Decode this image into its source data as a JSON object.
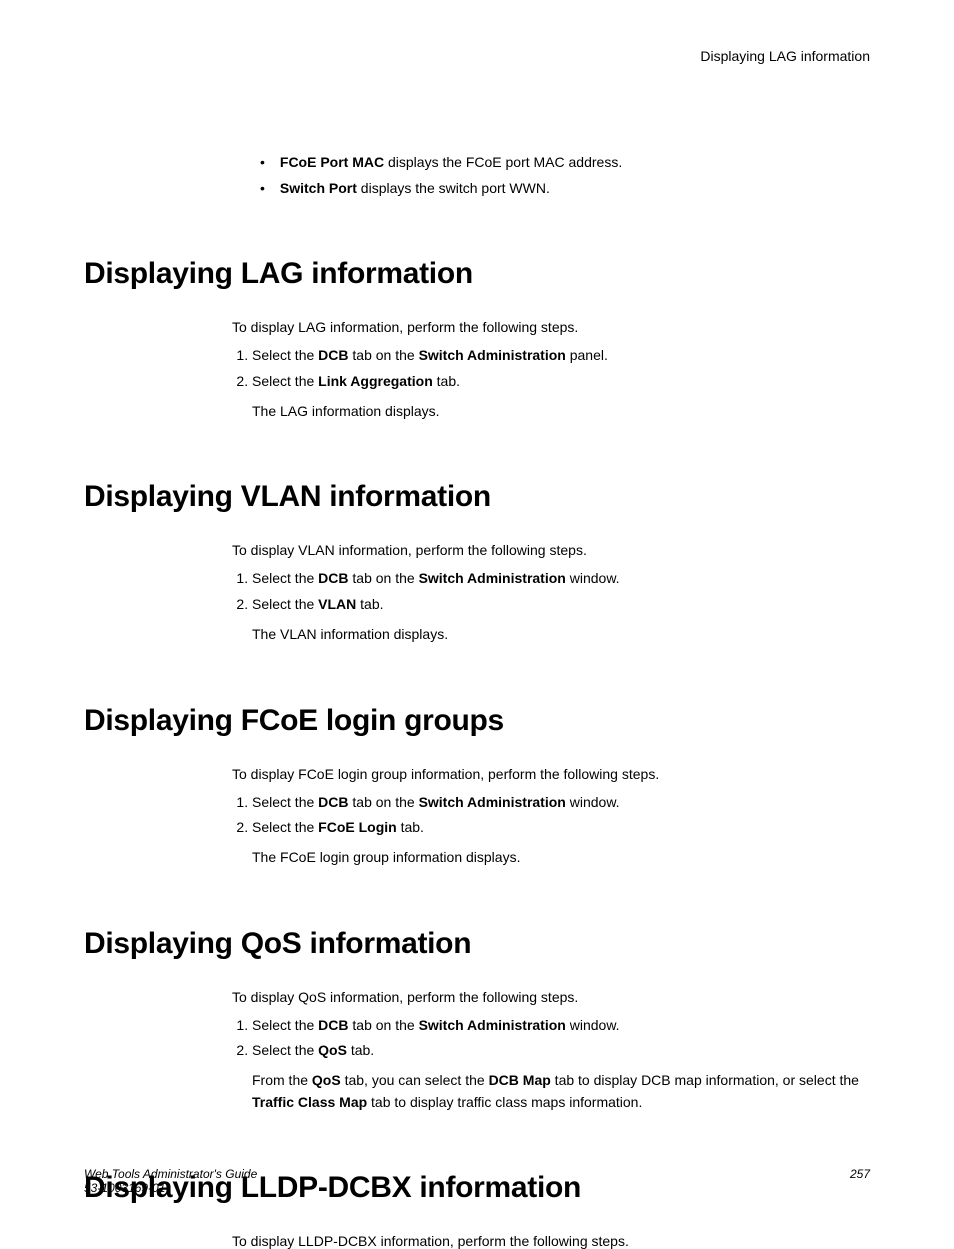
{
  "header": {
    "running": "Displaying LAG information"
  },
  "top_bullets": [
    {
      "bold": "FCoE Port MAC",
      "rest": " displays the FCoE port MAC address."
    },
    {
      "bold": "Switch Port",
      "rest": " displays the switch port WWN."
    }
  ],
  "sections": [
    {
      "heading": "Displaying LAG information",
      "intro": "To display LAG information, perform the following steps.",
      "steps": [
        {
          "pre": "Select the ",
          "b1": "DCB",
          "mid": " tab on the ",
          "b2": "Switch Administration",
          "post": " panel."
        },
        {
          "pre": "Select the ",
          "b1": "Link Aggregation",
          "mid": "",
          "b2": "",
          "post": " tab."
        }
      ],
      "result": "The LAG information displays."
    },
    {
      "heading": "Displaying VLAN information",
      "intro": "To display VLAN information, perform the following steps.",
      "steps": [
        {
          "pre": "Select the ",
          "b1": "DCB",
          "mid": " tab on the ",
          "b2": "Switch Administration",
          "post": " window."
        },
        {
          "pre": "Select the ",
          "b1": "VLAN",
          "mid": "",
          "b2": "",
          "post": " tab."
        }
      ],
      "result": "The VLAN information displays."
    },
    {
      "heading": "Displaying FCoE login groups",
      "intro": "To display FCoE login group information, perform the following steps.",
      "steps": [
        {
          "pre": "Select the ",
          "b1": "DCB",
          "mid": " tab on the ",
          "b2": "Switch Administration",
          "post": " window."
        },
        {
          "pre": "Select the ",
          "b1": "FCoE Login",
          "mid": "",
          "b2": "",
          "post": " tab."
        }
      ],
      "result": "The FCoE login group information displays."
    },
    {
      "heading": "Displaying QoS information",
      "intro": "To display QoS information, perform the following steps.",
      "steps": [
        {
          "pre": "Select the ",
          "b1": "DCB",
          "mid": " tab on the ",
          "b2": "Switch Administration",
          "post": " window."
        },
        {
          "pre": "Select the ",
          "b1": "QoS",
          "mid": "",
          "b2": "",
          "post": " tab."
        }
      ],
      "result_rich": {
        "p1": "From the ",
        "b1": "QoS",
        "p2": " tab, you can select the ",
        "b2": "DCB Map",
        "p3": " tab to display DCB map information, or select the ",
        "b3": "Traffic Class Map",
        "p4": " tab to display traffic class maps information."
      }
    },
    {
      "heading": "Displaying LLDP-DCBX information",
      "intro": "To display LLDP-DCBX information, perform the following steps."
    }
  ],
  "footer": {
    "title": "Web Tools Administrator's Guide",
    "docnum": "53-1003169-01",
    "page": "257"
  }
}
